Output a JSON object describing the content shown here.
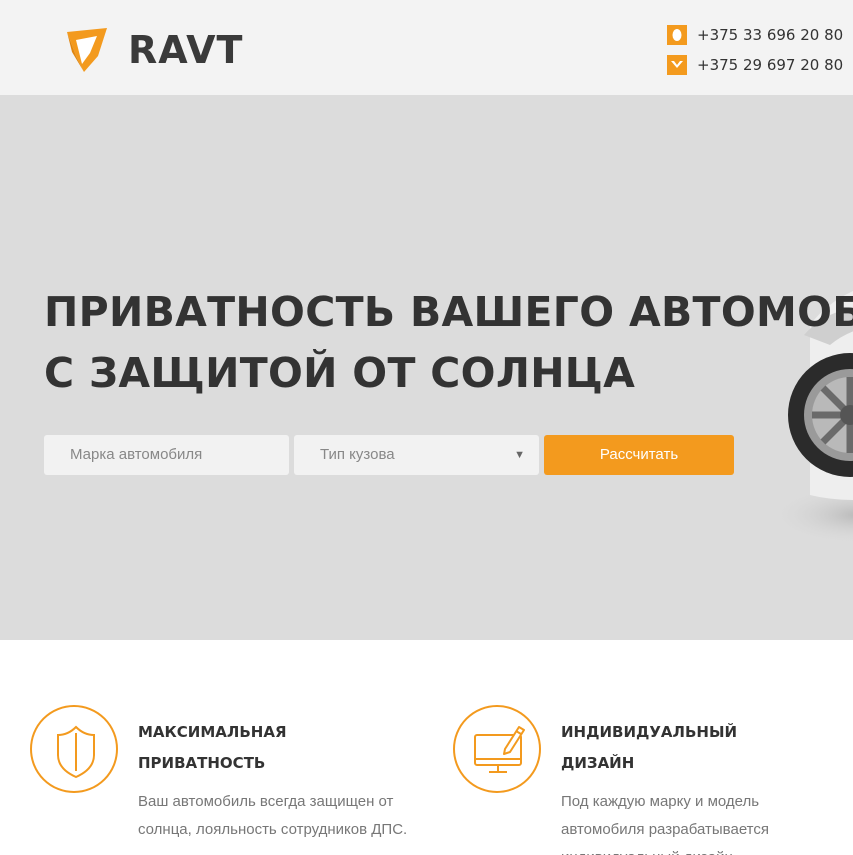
{
  "header": {
    "logo_text": "RAVT",
    "logo_icon": "ravt-logo-icon",
    "phones": [
      {
        "number": "+375 33 696 20 80",
        "icon": "mts-icon"
      },
      {
        "number": "+375 29 697 20 80",
        "icon": "velcom-icon"
      }
    ]
  },
  "hero": {
    "title_line1": "ПРИВАТНОСТЬ ВАШЕГО АВТОМОБИЛЯ",
    "title_line2": "С ЗАЩИТОЙ ОТ СОЛНЦА",
    "form": {
      "brand_placeholder": "Марка автомобиля",
      "body_type_selected": "Тип кузова",
      "submit_label": "Рассчитать"
    }
  },
  "features": [
    {
      "icon": "shield-icon",
      "title_line1": "МАКСИМАЛЬНАЯ",
      "title_line2": "ПРИВАТНОСТЬ",
      "text_line1": "Ваш автомобиль всегда защищен от",
      "text_line2": "солнца, лояльность сотрудников ДПС."
    },
    {
      "icon": "monitor-pencil-icon",
      "title_line1": "ИНДИВИДУАЛЬНЫЙ",
      "title_line2": "ДИЗАЙН",
      "text_line1": "Под каждую марку и модель",
      "text_line2": "автомобиля разрабатывается",
      "text_line3": "индивидуальный дизайн"
    }
  ],
  "colors": {
    "accent": "#f39a1e",
    "header_bg": "#f3f3f3",
    "hero_bg": "#dcdcdc",
    "text_dark": "#333333",
    "text_muted": "#777777"
  }
}
